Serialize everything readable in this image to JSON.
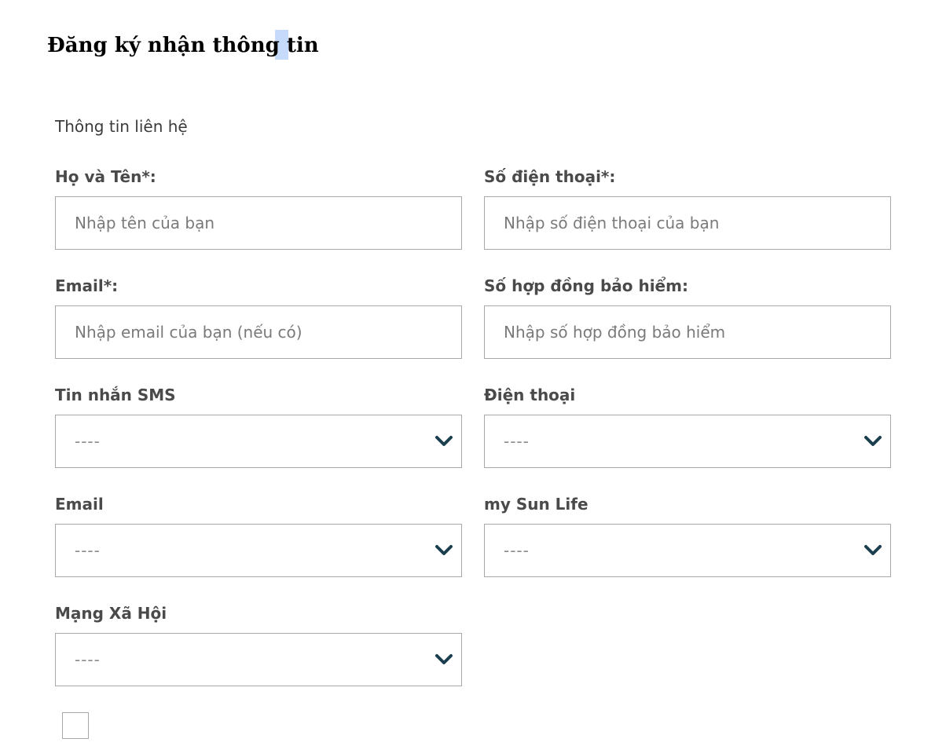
{
  "page": {
    "title": "Đăng ký nhận thông tin",
    "section_label": "Thông tin liên hệ"
  },
  "form": {
    "full_name": {
      "label": "Họ và Tên*:",
      "placeholder": "Nhập tên của bạn",
      "value": ""
    },
    "phone": {
      "label": "Số điện thoại*:",
      "placeholder": "Nhập số điện thoại của bạn",
      "value": ""
    },
    "email": {
      "label": "Email*:",
      "placeholder": "Nhập email của bạn (nếu có)",
      "value": ""
    },
    "contract_number": {
      "label": "Số hợp đồng bảo hiểm:",
      "placeholder": "Nhập số hợp đồng bảo hiểm",
      "value": ""
    },
    "sms": {
      "label": "Tin nhắn SMS",
      "selected": "----"
    },
    "phone_call": {
      "label": "Điện thoại",
      "selected": "----"
    },
    "email_channel": {
      "label": "Email",
      "selected": "----"
    },
    "my_sun_life": {
      "label": "my Sun Life",
      "selected": "----"
    },
    "social_network": {
      "label": "Mạng Xã Hội",
      "selected": "----"
    },
    "consent_checked": false
  },
  "icons": {
    "select_chevron": "chevron-down-icon"
  },
  "colors": {
    "chevron": "#1c3f4f",
    "border": "#a8a8a8",
    "selection_highlight": "#c6dafc"
  }
}
